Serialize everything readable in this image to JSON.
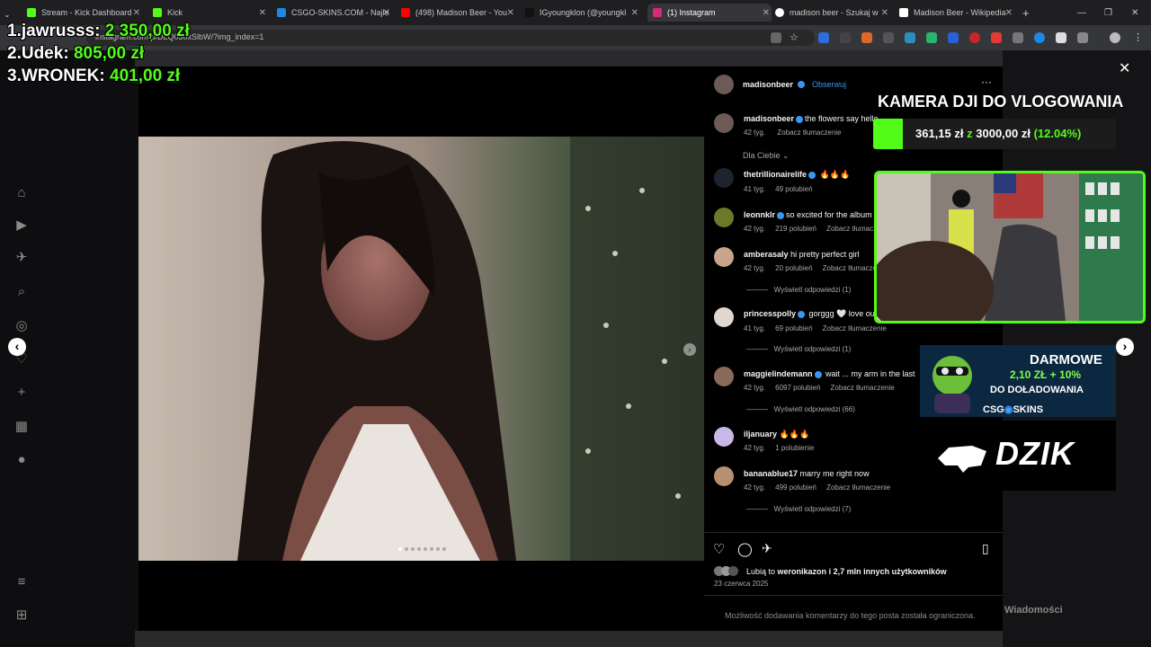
{
  "browser": {
    "tabs": [
      {
        "label": "Stream - Kick Dashboard",
        "color": "#53fc18"
      },
      {
        "label": "Kick",
        "color": "#53fc18"
      },
      {
        "label": "CSGO-SKINS.COM - Najle",
        "color": "#1e88e5"
      },
      {
        "label": "(498) Madison Beer - You",
        "color": "#ff0000"
      },
      {
        "label": "IGyoungklon (@youngkl",
        "color": "#111111"
      },
      {
        "label": "(1) Instagram",
        "color": "#d62976"
      },
      {
        "label": "madison beer - Szukaj w",
        "color": "#ffffff"
      },
      {
        "label": "Madison Beer - Wikipedia",
        "color": "#ffffff"
      }
    ],
    "url": "instagram.com/p/DLQ030xSlbW/?img_index=1"
  },
  "leaderboard": [
    {
      "rank": "1.",
      "name": "jawrusss:",
      "amount": "2 350,00 zł"
    },
    {
      "rank": "2.",
      "name": "Udek:",
      "amount": "805,00 zł"
    },
    {
      "rank": "3.",
      "name": "WRONEK:",
      "amount": "401,00 zł"
    }
  ],
  "post": {
    "author": "madisonbeer",
    "follow": "Obserwuj",
    "caption_author": "madisonbeer",
    "caption": "the flowers say hello",
    "caption_time": "42 tyg.",
    "translate": "Zobacz tłumaczenie",
    "filter": "Dla Ciebie",
    "comments": [
      {
        "user": "thetrillionairelife",
        "text": "🔥🔥🔥",
        "time": "41 tyg.",
        "likes": "49 polubień",
        "translate": "",
        "replies": ""
      },
      {
        "user": "leonnklr",
        "text": "so excited for the album",
        "time": "42 tyg.",
        "likes": "219 polubień",
        "translate": "Zobacz tłumaczenie",
        "replies": ""
      },
      {
        "user": "amberasaly",
        "text": "hi pretty perfect girl",
        "time": "42 tyg.",
        "likes": "20 polubień",
        "translate": "Zobacz tłumaczenie",
        "replies": "Wyświetl odpowiedzi (1)"
      },
      {
        "user": "princesspolly",
        "text": "gorggg 🤍 love our",
        "time": "41 tyg.",
        "likes": "69 polubień",
        "translate": "Zobacz tłumaczenie",
        "replies": "Wyświetl odpowiedzi (1)"
      },
      {
        "user": "maggielindemann",
        "text": "wait ... my arm in the last",
        "time": "42 tyg.",
        "likes": "6097 polubień",
        "translate": "Zobacz tłumaczenie",
        "replies": "Wyświetl odpowiedzi (66)"
      },
      {
        "user": "iljanuary",
        "text": "🔥🔥🔥",
        "time": "42 tyg.",
        "likes": "1 polubienie",
        "translate": "",
        "replies": ""
      },
      {
        "user": "bananablue17",
        "text": "marry me right now",
        "time": "42 tyg.",
        "likes": "499 polubień",
        "translate": "Zobacz tłumaczenie",
        "replies": "Wyświetl odpowiedzi (7)"
      }
    ],
    "liked_by_prefix": "Lubią to",
    "liked_by_user": "weronikazon",
    "liked_by_suffix": "i 2,7 mln innych użytkowników",
    "date": "23 czerwca 2025",
    "comments_limited": "Możliwość dodawania komentarzy do tego posta została ograniczona.",
    "messages": "Wiadomości"
  },
  "stream_overlay": {
    "goal_title": "KAMERA DJI DO VLOGOWANIA",
    "goal_current": "361,15 zł",
    "goal_sep": "z",
    "goal_target": "3000,00 zł",
    "goal_percent": "(12.04%)",
    "goal_progress": 0.1204,
    "ad1_line1": "DARMOWE",
    "ad1_line2": "2,10 ZŁ + 10%",
    "ad1_line3": "DO DOŁADOWANIA",
    "ad1_brand": "CSG",
    "ad1_brand2": "SKINS",
    "ad2_brand": "DZIK"
  },
  "colors": {
    "accent": "#53fc18",
    "ig_blue": "#3897f0"
  }
}
